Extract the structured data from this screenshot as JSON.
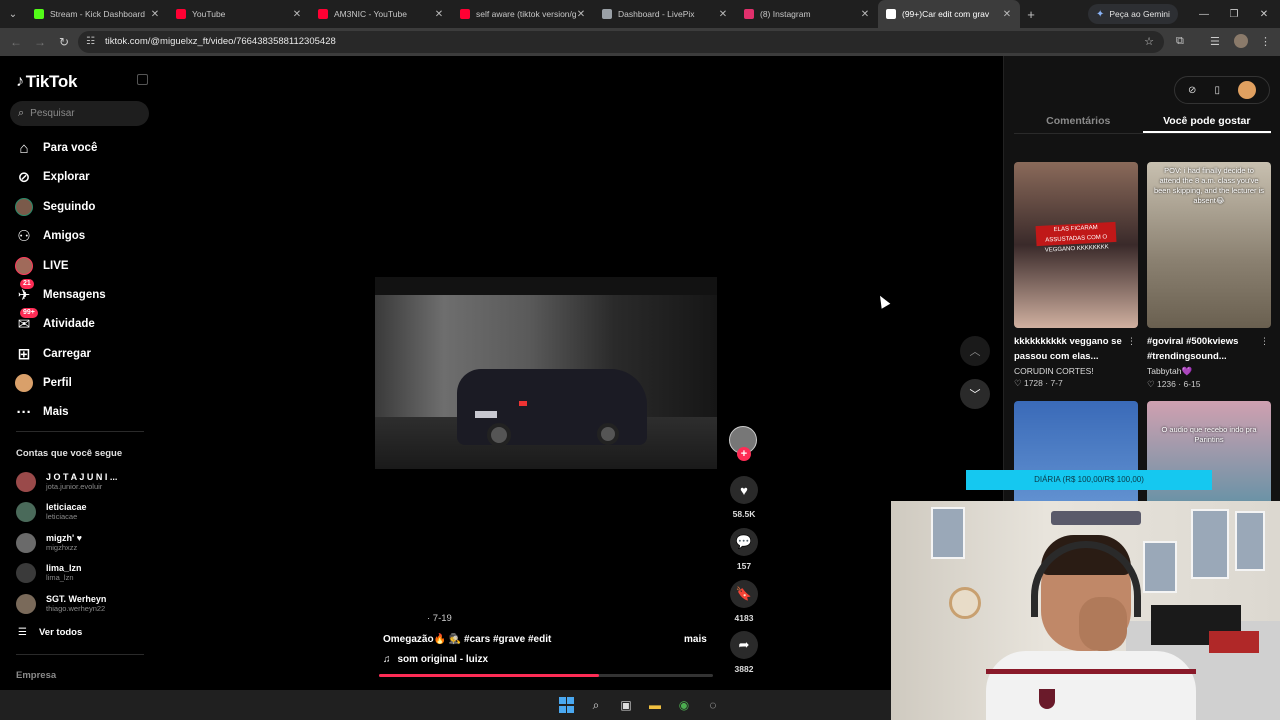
{
  "browser": {
    "tabs": [
      {
        "title": "Stream - Kick Dashboard",
        "color": "#53fc18"
      },
      {
        "title": "YouTube",
        "color": "#ff0033"
      },
      {
        "title": "AM3NIC - YouTube",
        "color": "#ff0033"
      },
      {
        "title": "self aware (tiktok version/g",
        "color": "#ff0033"
      },
      {
        "title": "Dashboard - LivePix",
        "color": "#9aa0a6"
      },
      {
        "title": "(8) Instagram",
        "color": "#e1306c"
      },
      {
        "title": "(99+)Car edit com grav",
        "color": "#ffffff"
      }
    ],
    "gemini_label": "Peça ao Gemini",
    "url": "tiktok.com/@miguelxz_ft/video/7664383588112305428"
  },
  "tiktok": {
    "logo": "TikTok",
    "search_placeholder": "Pesquisar",
    "nav": [
      {
        "label": "Para você",
        "icon": "home-icon",
        "glyph": "⌂"
      },
      {
        "label": "Explorar",
        "icon": "compass-icon",
        "glyph": "⊘"
      },
      {
        "label": "Seguindo",
        "icon": "following-avatar-icon"
      },
      {
        "label": "Amigos",
        "icon": "friends-icon",
        "glyph": "⚇"
      },
      {
        "label": "LIVE",
        "icon": "live-avatar-icon"
      },
      {
        "label": "Mensagens",
        "icon": "messages-icon",
        "glyph": "✈",
        "badge": "21"
      },
      {
        "label": "Atividade",
        "icon": "activity-icon",
        "glyph": "✉",
        "badge": "99+"
      },
      {
        "label": "Carregar",
        "icon": "upload-icon",
        "glyph": "⊞"
      },
      {
        "label": "Perfil",
        "icon": "profile-avatar-icon"
      },
      {
        "label": "Mais",
        "icon": "more-icon",
        "glyph": "···"
      }
    ],
    "following_title": "Contas que você segue",
    "following": [
      {
        "name": "J O T A  J U N I ...",
        "handle": "jota.junior.evoluir",
        "color": "#9a4a4a"
      },
      {
        "name": "leticiacae",
        "handle": "leticiacae",
        "color": "#4a6a5a"
      },
      {
        "name": "migzh' ♥",
        "handle": "migzhxzz",
        "color": "#6a6a6a"
      },
      {
        "name": "lima_lzn",
        "handle": "lima_lzn",
        "color": "#3a3a3a"
      },
      {
        "name": "SGT. Werheyn",
        "handle": "thiago.werheyn22",
        "color": "#7a6a5a"
      }
    ],
    "see_all": "Ver todos",
    "footer": "Empresa",
    "video": {
      "date": "· 7-19",
      "caption": "Omegazão🔥 🕵️ #cars #grave #edit",
      "more": "mais",
      "music": "som original - luizx",
      "progress": 0.66
    },
    "actions": [
      {
        "name": "like-button",
        "icon": "heart-icon",
        "glyph": "♥",
        "count": "58.5K"
      },
      {
        "name": "comment-button",
        "icon": "comment-icon",
        "glyph": "💬",
        "count": "157"
      },
      {
        "name": "save-button",
        "icon": "bookmark-icon",
        "glyph": "🔖",
        "count": "4183"
      },
      {
        "name": "share-button",
        "icon": "share-icon",
        "glyph": "➦",
        "count": "3882"
      }
    ],
    "panel": {
      "tabs": [
        "Comentários",
        "Você pode gostar"
      ],
      "active_tab": 1,
      "cards": [
        {
          "title": "kkkkkkkkkk veggano se passou com elas...",
          "author": "CORUDIN CORTES!",
          "stats": "♡ 1728 · 7-7",
          "bg": "linear-gradient(180deg,#8a6a5a,#3a2a2a 50%,#d0b0a0)",
          "overlay": "",
          "banner": "ELAS FICARAM ASSUSTADAS COM O VEGGANO KKKKKKKK"
        },
        {
          "title": "#goviral #500kviews #trendingsound...",
          "author": "Tabbytah💜",
          "stats": "♡ 1236 · 6-15",
          "bg": "linear-gradient(180deg,#c8c0b0,#8a8070 60%,#6a6050)",
          "overlay": "POV: i had finally decide to attend the 8 a.m. class you've been skipping, and the lecturer is absent😂",
          "banner": ""
        },
        {
          "title": "",
          "author": "",
          "stats": "",
          "bg": "linear-gradient(180deg,#3a6ab8,#7aaae0)",
          "overlay": "",
          "banner": ""
        },
        {
          "title": "",
          "author": "",
          "stats": "",
          "bg": "linear-gradient(180deg,#d0a0b0,#2a8aa0)",
          "overlay": "O audio que recebo indo pra Parintins",
          "banner": ""
        }
      ]
    }
  },
  "overlay": {
    "donation": "DIÁRIA (R$ 100,00/R$ 100,00)"
  },
  "colors": {
    "accent": "#fe2c55",
    "donation": "#15c8f0"
  }
}
